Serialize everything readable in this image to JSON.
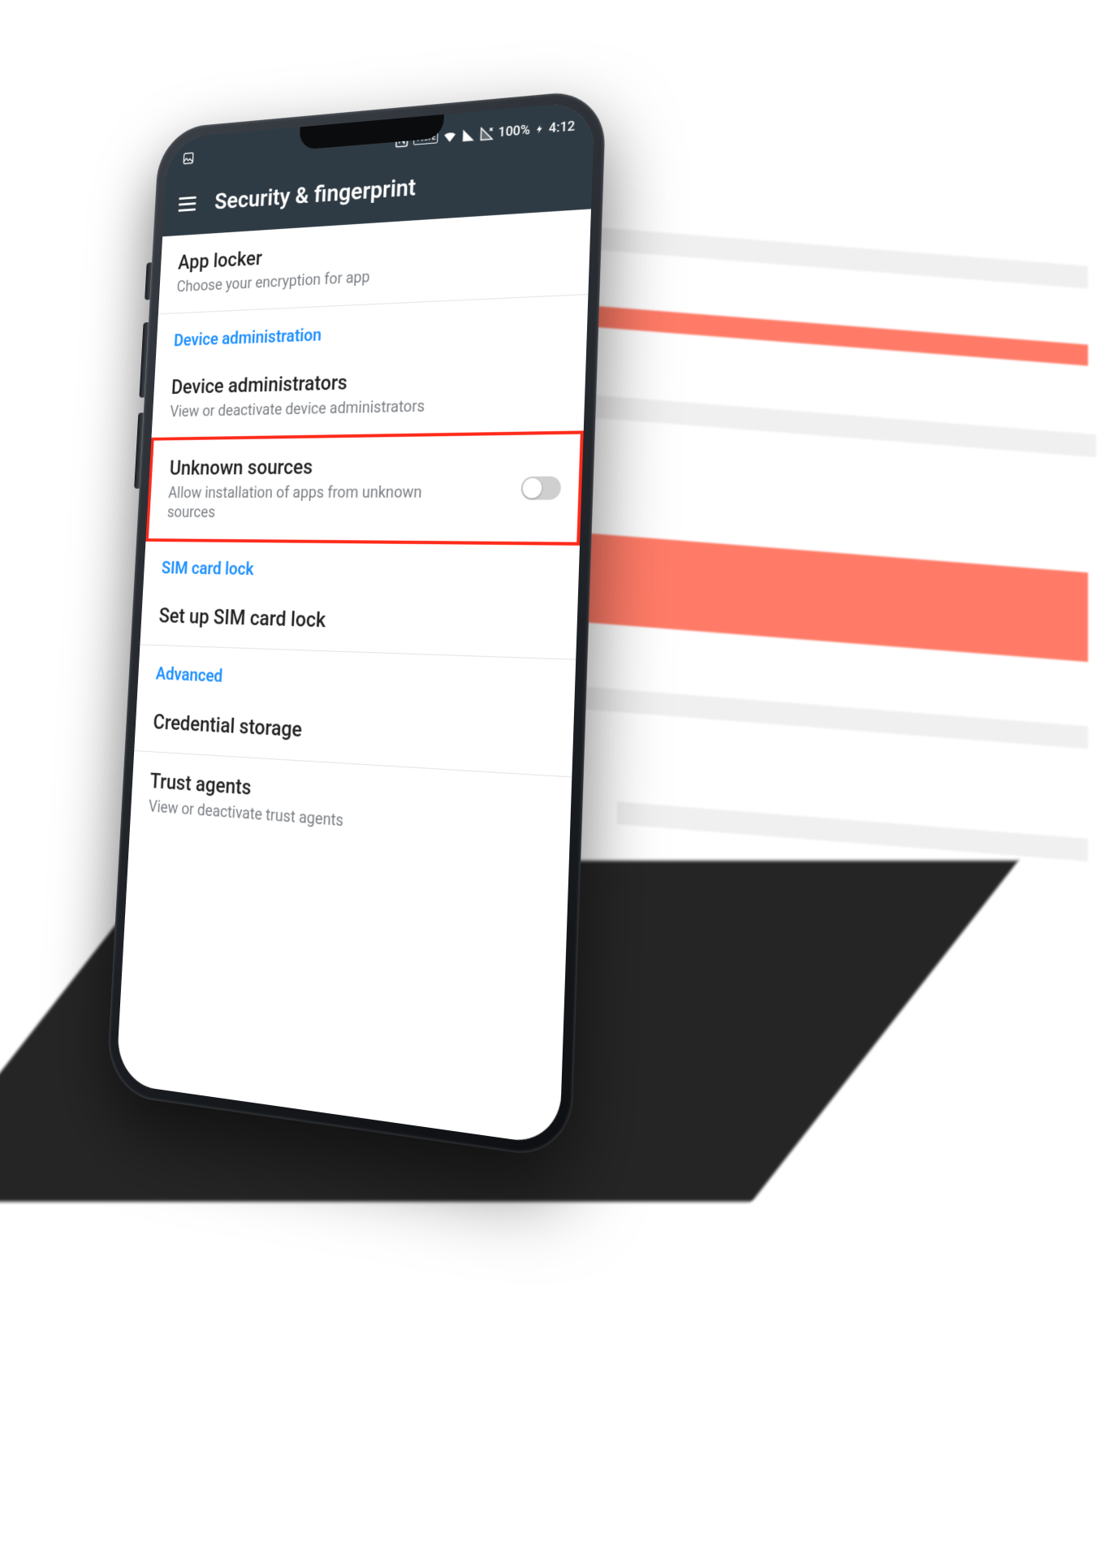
{
  "statusbar": {
    "nfc": "N",
    "volte": "VoLTE",
    "battery_pct": "100%",
    "time": "4:12"
  },
  "appbar": {
    "title": "Security & fingerprint"
  },
  "rows": {
    "app_locker": {
      "title": "App locker",
      "sub": "Choose your encryption for app"
    },
    "section_device_admin": "Device administration",
    "device_admins": {
      "title": "Device administrators",
      "sub": "View or deactivate device administrators"
    },
    "unknown_sources": {
      "title": "Unknown sources",
      "sub": "Allow installation of apps from unknown sources"
    },
    "section_sim": "SIM card lock",
    "sim_setup": {
      "title": "Set up SIM card lock"
    },
    "section_adv": "Advanced",
    "cred_storage": {
      "title": "Credential storage"
    },
    "trust_agents": {
      "title": "Trust agents",
      "sub": "View or deactivate trust agents"
    }
  },
  "colors": {
    "accent": "#1e90ff",
    "highlight_border": "#ff2a1a",
    "appbar_bg": "#2f3b44"
  }
}
